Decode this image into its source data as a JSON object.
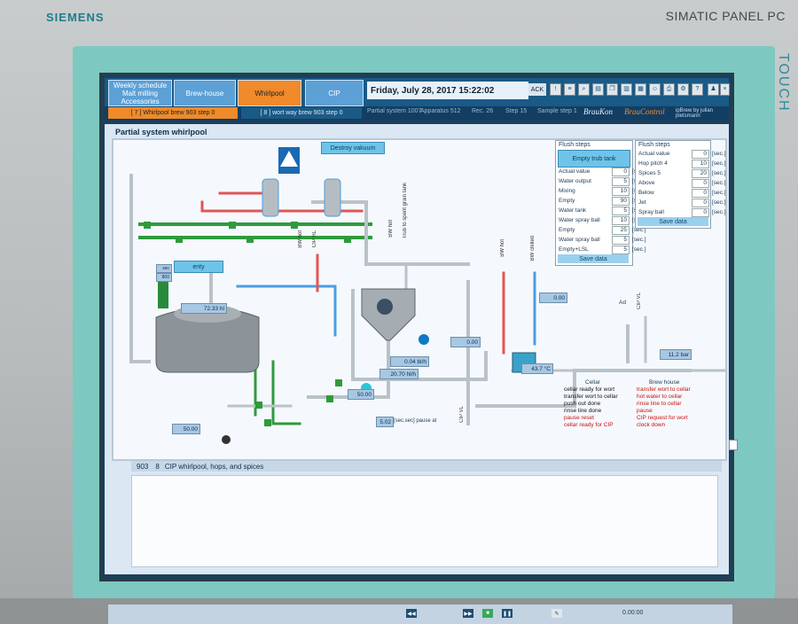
{
  "device": {
    "brand": "SIEMENS",
    "model": "SIMATIC PANEL PC",
    "touch_label": "TOUCH"
  },
  "nav": {
    "weekly": "Weekly schedule Malt milling Accessories",
    "brewhouse": "Brew-house",
    "whirlpool": "Whirlpool",
    "cip": "CIP"
  },
  "header": {
    "datetime": "Friday, July 28, 2017 15:22:02",
    "ack": "ACK"
  },
  "steps": {
    "step1": "[ 7 ] Whirlpool brew 903 step 0",
    "step2": "[ 8 ] wort way brew 903 step 0"
  },
  "info": {
    "partial": "Partial system 1007",
    "apparatus": "Apparatus 512",
    "rec": "Rec. 26",
    "step": "Step 15",
    "sample": "Sample step 1"
  },
  "brand": {
    "braukon": "BrauKon",
    "braucontrol": "BrauControl",
    "byline": "ipBrew by julian pietsmann"
  },
  "panel": {
    "title": "Partial system whirlpool",
    "destroy": "Destroy vakuum",
    "empty": "enty",
    "sign_num": "1",
    "flush1": {
      "title": "Flush steps",
      "button": "Empty trub tank",
      "rows": [
        {
          "label": "Actual value",
          "value": "0",
          "unit": "[sec.]"
        },
        {
          "label": "Water output",
          "value": "5",
          "unit": "[sec.]"
        },
        {
          "label": "Mixing",
          "value": "10",
          "unit": "[sec.]"
        },
        {
          "label": "Empty",
          "value": "90",
          "unit": "[sec.]"
        },
        {
          "label": "Water tank",
          "value": "5",
          "unit": "[sec.]"
        },
        {
          "label": "Water spray ball",
          "value": "10",
          "unit": "[sec.]"
        },
        {
          "label": "Empty",
          "value": "25",
          "unit": "[sec.]"
        },
        {
          "label": "Water spray ball",
          "value": "5",
          "unit": "[sec.]"
        },
        {
          "label": "Empty+LSL",
          "value": "5",
          "unit": "[sec.]"
        }
      ],
      "save": "Save data"
    },
    "flush2": {
      "title": "Flush steps",
      "rows": [
        {
          "label": "Actual value",
          "value": "0",
          "unit": "[sec.]"
        },
        {
          "label": "Hop pitch 4",
          "value": "10",
          "unit": "[sec.]"
        },
        {
          "label": "Spices 5",
          "value": "20",
          "unit": "[sec.]"
        },
        {
          "label": "Above",
          "value": "0",
          "unit": "[sec.]"
        },
        {
          "label": "Below",
          "value": "0",
          "unit": "[sec.]"
        },
        {
          "label": "Jet",
          "value": "0",
          "unit": "[sec.]"
        },
        {
          "label": "Spray ball",
          "value": "0",
          "unit": "[sec.]"
        }
      ],
      "save": "Save data"
    },
    "values": {
      "tank_level": "72.33 hl",
      "v1": "0.04 bl/h",
      "v2": "20.70 hl/h",
      "v3": "50.00",
      "v4": "50.00",
      "v5": "5.02",
      "v5_label": "[sec.sec] pause at",
      "v6": "0.00",
      "v7": "0.00",
      "v8": "43.7 °C",
      "v9": "11.2 bar",
      "side_top": "sec",
      "side_val": "800"
    },
    "pipes": {
      "bw_hot1": "BW hot",
      "cip_rl": "CIP RL",
      "trub": "Trub to spent grain tank",
      "bw_hot2": "BW hot",
      "bw_hot3": "BW hot",
      "bw_chilled": "BW chilled",
      "cip_vl": "CIP VL",
      "ad": "Ad",
      "cip_vl2": "CIP VL"
    },
    "cellar": {
      "title": "Cellar",
      "items": [
        {
          "text": "cellar ready for wort",
          "color": "#111111"
        },
        {
          "text": "transfer wort to cellar",
          "color": "#111111"
        },
        {
          "text": "push out done",
          "color": "#111111"
        },
        {
          "text": "rinse line done",
          "color": "#111111"
        },
        {
          "text": "pause reset",
          "color": "#cc1111"
        },
        {
          "text": "cellar ready for CIP",
          "color": "#cc1111"
        }
      ]
    },
    "brewhouse": {
      "title": "Brew house",
      "items": [
        {
          "text": "transfer wort to cellar",
          "color": "#cc1111"
        },
        {
          "text": "hot water to cellar",
          "color": "#cc1111"
        },
        {
          "text": "rinse line to cellar",
          "color": "#cc1111"
        },
        {
          "text": "pause",
          "color": "#cc1111"
        },
        {
          "text": "CIP request for wort",
          "color": "#cc1111"
        },
        {
          "text": "clock down",
          "color": "#cc1111"
        }
      ]
    }
  },
  "program": {
    "brew": "903",
    "step": "8",
    "name": "CIP whirlpool, hops, and spices"
  },
  "footer": {
    "time": "0.00:00"
  },
  "colors": {
    "accent": "#f08a2a",
    "nav": "#5ca0d6",
    "bg": "#1d3f5a"
  }
}
